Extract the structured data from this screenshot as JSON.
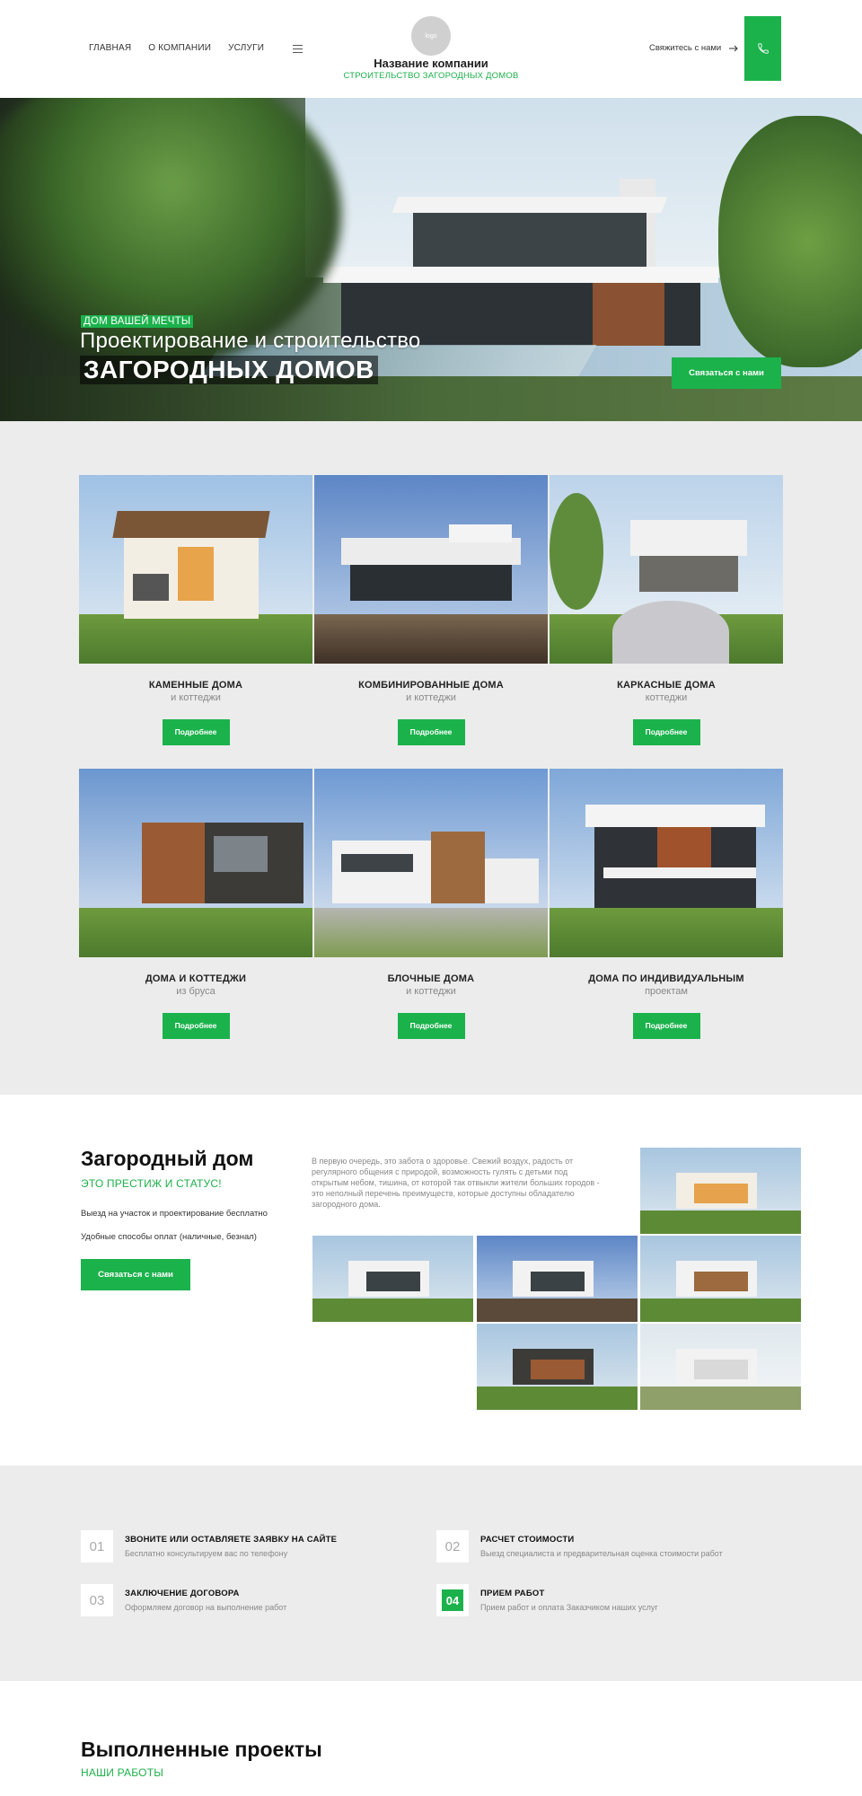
{
  "header": {
    "nav": [
      "ГЛАВНАЯ",
      "О КОМПАНИИ",
      "УСЛУГИ"
    ],
    "logo_text": "logo",
    "company_name": "Название компании",
    "company_tagline": "СТРОИТЕЛЬСТВО ЗАГОРОДНЫХ ДОМОВ",
    "contact_link": "Свяжитесь с нами",
    "accent_color": "#1bb24c"
  },
  "hero": {
    "tag": "ДОМ ВАШЕЙ МЕЧТЫ",
    "title": "Проектирование и строительство",
    "title_big": "ЗАГОРОДНЫХ ДОМОВ",
    "button": "Связаться с нами"
  },
  "catalog": {
    "cards": [
      {
        "title": "КАМЕННЫЕ ДОМА",
        "sub": "и коттеджи",
        "button": "Подробнее"
      },
      {
        "title": "КОМБИНИРОВАННЫЕ ДОМА",
        "sub": "и коттеджи",
        "button": "Подробнее"
      },
      {
        "title": "КАРКАСНЫЕ ДОМА",
        "sub": "коттеджи",
        "button": "Подробнее"
      },
      {
        "title": "ДОМА И КОТТЕДЖИ",
        "sub": "из бруса",
        "button": "Подробнее"
      },
      {
        "title": "БЛОЧНЫЕ ДОМА",
        "sub": "и коттеджи",
        "button": "Подробнее"
      },
      {
        "title": "ДОМА ПО ИНДИВИДУАЛЬНЫМ",
        "sub": "проектам",
        "button": "Подробнее"
      }
    ]
  },
  "about": {
    "title": "Загородный дом",
    "slogan": "ЭТО ПРЕСТИЖ И СТАТУС!",
    "line1": "Выезд на участок и проектирование бесплатно",
    "line2": "Удобные способы оплат (наличные, безнал)",
    "button": "Связаться с нами",
    "paragraph": "В первую очередь, это забота о здоровье. Свежий воздух, радость от регулярного общения с природой, возможность гулять с детьми под открытым небом, тишина, от которой так отвыкли жители больших городов - это неполный перечень преимуществ, которые доступны обладателю загородного дома."
  },
  "steps": [
    {
      "num": "01",
      "title": "ЗВОНИТЕ ИЛИ ОСТАВЛЯЕТЕ ЗАЯВКУ НА САЙТЕ",
      "desc": "Бесплатно консультируем вас по телефону"
    },
    {
      "num": "02",
      "title": "РАСЧЕТ СТОИМОСТИ",
      "desc": "Выезд специалиста и предварительная оценка стоимости работ"
    },
    {
      "num": "03",
      "title": "ЗАКЛЮЧЕНИЕ ДОГОВОРА",
      "desc": "Оформляем договор на выполнение работ"
    },
    {
      "num": "04",
      "title": "ПРИЕМ РАБОТ",
      "desc": "Прием работ и оплата Заказчиком наших услуг"
    }
  ],
  "projects": {
    "title": "Выполненные проекты",
    "sub": "НАШИ РАБОТЫ"
  }
}
